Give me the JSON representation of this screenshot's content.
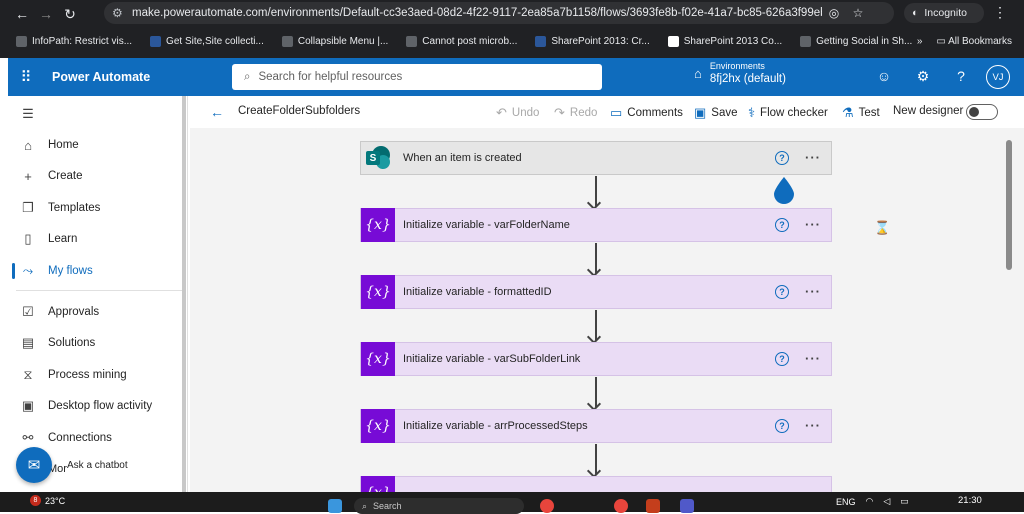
{
  "browser": {
    "url": "make.powerautomate.com/environments/Default-cc3e3aed-08d2-4f22-9117-2ea85a7b1158/flows/3693fe8b-f02e-41a7-bc85-626a3f99ebd6?v...",
    "incognito_label": "Incognito",
    "bookmarks": [
      "InfoPath: Restrict vis...",
      "Get Site,Site collecti...",
      "Collapsible Menu |...",
      "Cannot post microb...",
      "SharePoint 2013: Cr...",
      "SharePoint 2013 Co...",
      "Getting Social in Sh..."
    ],
    "more_bookmarks": "»",
    "all_bookmarks": "All Bookmarks"
  },
  "header": {
    "app_name": "Power Automate",
    "search_placeholder": "Search for helpful resources",
    "env_label": "Environments",
    "env_value": "8fj2hx (default)",
    "user_initials": "VJ"
  },
  "sidebar": {
    "items": [
      {
        "label": "Home",
        "icon": "home-icon"
      },
      {
        "label": "Create",
        "icon": "plus-icon"
      },
      {
        "label": "Templates",
        "icon": "templates-icon"
      },
      {
        "label": "Learn",
        "icon": "book-icon"
      },
      {
        "label": "My flows",
        "icon": "flows-icon"
      },
      {
        "label": "Approvals",
        "icon": "approvals-icon"
      },
      {
        "label": "Solutions",
        "icon": "solutions-icon"
      },
      {
        "label": "Process mining",
        "icon": "process-mining-icon"
      },
      {
        "label": "Desktop flow activity",
        "icon": "desktop-flow-icon"
      },
      {
        "label": "Connections",
        "icon": "connections-icon"
      }
    ],
    "partial_item": "Mor",
    "chatbot_label": "Ask a chatbot"
  },
  "toolbar": {
    "flow_name": "CreateFolderSubfolders",
    "undo": "Undo",
    "redo": "Redo",
    "comments": "Comments",
    "save": "Save",
    "flow_checker": "Flow checker",
    "test": "Test",
    "new_designer": "New designer"
  },
  "flow": {
    "trigger": "When an item is created",
    "actions": [
      "Initialize variable - varFolderName",
      "Initialize variable - formattedID",
      "Initialize variable - varSubFolderLink",
      "Initialize variable - arrProcessedSteps"
    ],
    "variable_icon": "{x}"
  },
  "taskbar": {
    "temperature": "23°C",
    "weather_badge": "8",
    "search": "Search",
    "language": "ENG",
    "time": "21:30"
  }
}
